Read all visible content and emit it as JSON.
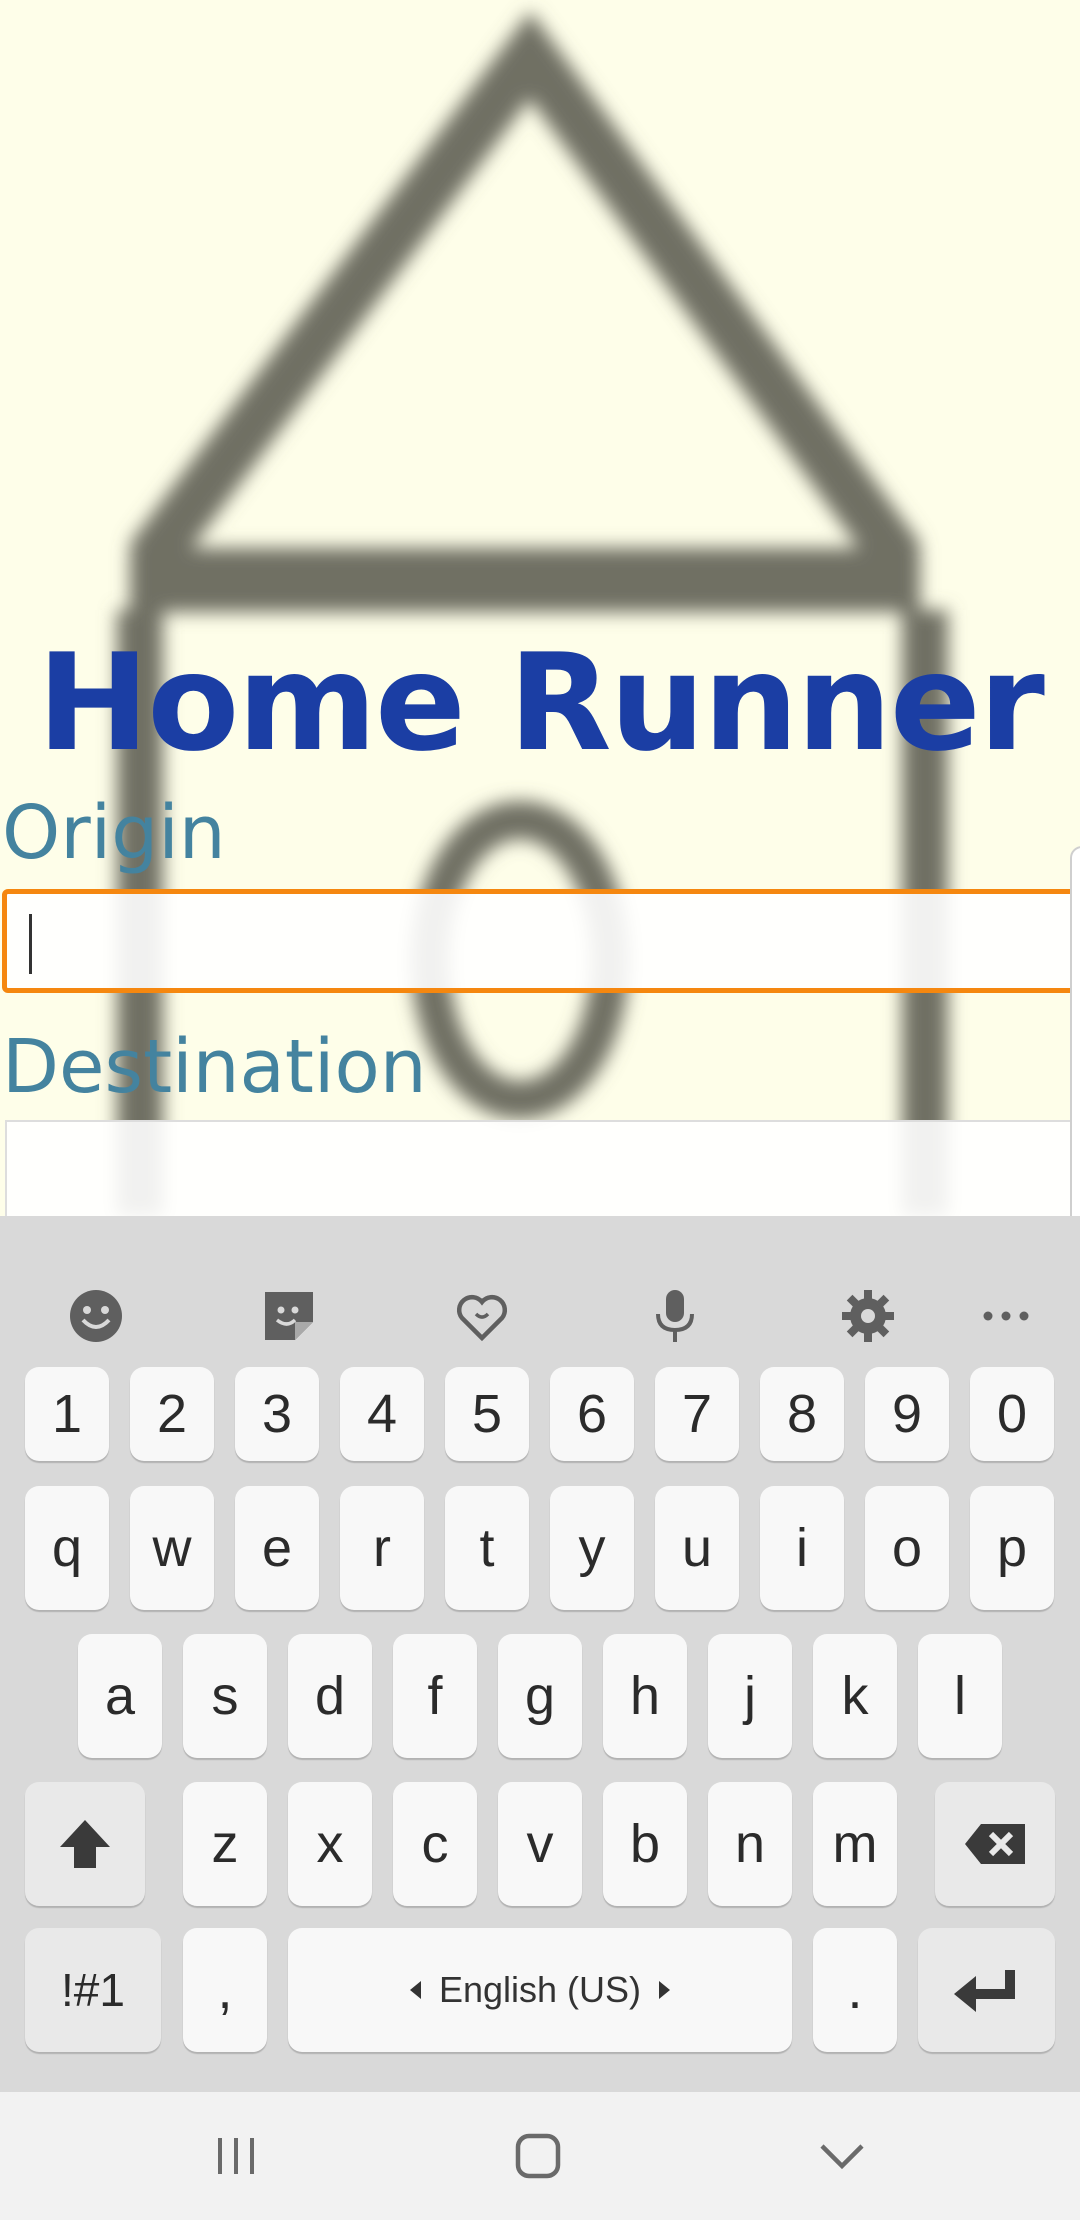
{
  "app": {
    "title": "Home Runner"
  },
  "form": {
    "origin_label": "Origin",
    "origin_value": "",
    "destination_label": "Destination",
    "destination_value": ""
  },
  "keyboard": {
    "toolbar": [
      "emoji-icon",
      "sticker-icon",
      "bitmoji-icon",
      "microphone-icon",
      "settings-gear-icon",
      "more-options-icon"
    ],
    "rows": {
      "numbers": [
        "1",
        "2",
        "3",
        "4",
        "5",
        "6",
        "7",
        "8",
        "9",
        "0"
      ],
      "row1": [
        "q",
        "w",
        "e",
        "r",
        "t",
        "y",
        "u",
        "i",
        "o",
        "p"
      ],
      "row2": [
        "a",
        "s",
        "d",
        "f",
        "g",
        "h",
        "j",
        "k",
        "l"
      ],
      "row3": [
        "z",
        "x",
        "c",
        "v",
        "b",
        "n",
        "m"
      ]
    },
    "symbols_key": "!#1",
    "comma_key": ",",
    "period_key": ".",
    "space_label": "English (US)"
  },
  "colors": {
    "title": "#1b3ea4",
    "label": "#44839f",
    "focus_border": "#f5870f",
    "background": "#fefee9"
  }
}
